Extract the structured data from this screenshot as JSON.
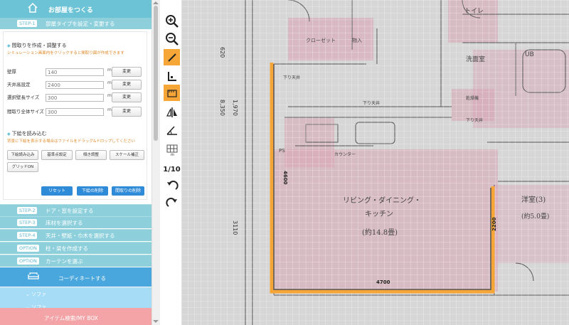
{
  "header": {
    "title": "お部屋をつくる"
  },
  "step1": {
    "badge": "STEP-1",
    "label": "部屋タイプを設定・変更する"
  },
  "madori": {
    "title": "間取りを作成・調整する",
    "note": "シミュレーション画面内をクリックすると間取り図が作成できます",
    "fields": [
      {
        "label": "壁厚",
        "value": "140",
        "unit": "mm",
        "button": "変更"
      },
      {
        "label": "天井高設定",
        "value": "2400",
        "unit": "mm",
        "button": "変更"
      },
      {
        "label": "選択壁長サイズ",
        "value": "300",
        "unit": "mm",
        "button": "変更"
      },
      {
        "label": "間取り全体サイズ",
        "value": "300",
        "unit": "mm",
        "button": "変更"
      }
    ]
  },
  "shita": {
    "title": "下絵を読み込む",
    "note": "背景に下絵を表示する場合はファイルをドラッグ&ドロップしてください",
    "tools": [
      "下絵読み込み",
      "基準点設定",
      "傾き調整",
      "スケール補正",
      "グリッドON"
    ]
  },
  "actions": {
    "reset": "リセット",
    "delete_shita": "下絵の削除",
    "delete_madori": "間取りの削除"
  },
  "steps": [
    {
      "badge": "STEP-2",
      "label": "ドア・窓を設定する"
    },
    {
      "badge": "STEP-3",
      "label": "床材を選択する"
    },
    {
      "badge": "STEP-4",
      "label": "天井・壁紙・巾木を選択する"
    },
    {
      "badge": "OPTION",
      "label": "柱・梁を作成する"
    },
    {
      "badge": "OPTION",
      "label": "カーテンを選ぶ"
    }
  ],
  "coordinate": {
    "label": "コーディネートする"
  },
  "sub_items": [
    "ソファ",
    "ソファ"
  ],
  "item_box": {
    "label": "アイテム検索/MY BOX"
  },
  "toolbar": {
    "scale_label": "1/10"
  },
  "plan": {
    "room_label_1": "リビング・ダイニング・",
    "room_label_2": "キッチン",
    "room_label_3": "(約14.8畳)",
    "dim_bottom": "4700",
    "dim_left": "4600",
    "dim_right": "2200",
    "room_right": "洋室(3)",
    "room_right_size": "(約5.0畳)",
    "toilet": "トイレ",
    "senmen": "洗面室",
    "ub": "UB",
    "kitchen": "カウンター",
    "ps": "PS",
    "dim_620": "620",
    "dim_8350": "8,350",
    "dim_1970": "1,970",
    "dim_3110": "3110",
    "closet": "クローゼット",
    "monoire": "物入",
    "sagari_1": "下り天井",
    "sagari_2": "下り天井",
    "sagari_3": "下り天井",
    "dryer": "乾燥機"
  },
  "colors": {
    "accent": "#6dc3d6",
    "blue_button": "#2f8ad8",
    "wall": "#f5a636",
    "item_bar": "#f4a3a6"
  }
}
